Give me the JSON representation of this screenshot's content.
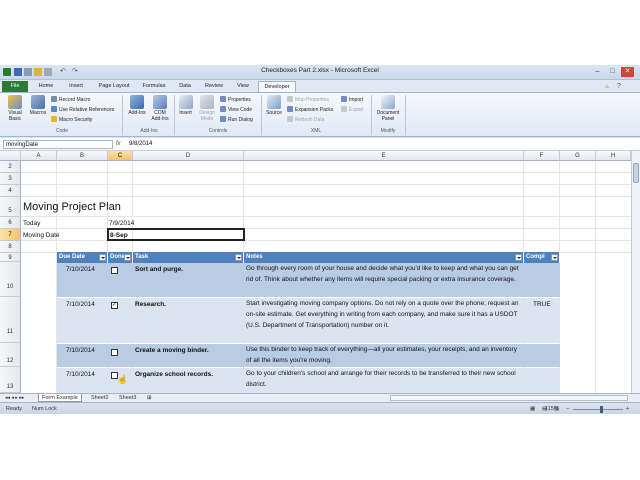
{
  "window": {
    "title": "Checkboxes Part 2.xlsx - Microsoft Excel",
    "controls": [
      "–",
      "□",
      "✕"
    ]
  },
  "ribbon": {
    "tabs": [
      "File",
      "Home",
      "Insert",
      "Page Layout",
      "Formulas",
      "Data",
      "Review",
      "View",
      "Developer"
    ],
    "active_tab": "Developer",
    "groups": {
      "code": {
        "label": "Code",
        "visual_basic": "Visual Basic",
        "macros": "Macros",
        "record_macro": "Record Macro",
        "relative_refs": "Use Relative References",
        "macro_security": "Macro Security"
      },
      "addins": {
        "label": "Add-Ins",
        "addins": "Add-Ins",
        "com_addins": "COM Add-Ins"
      },
      "controls": {
        "label": "Controls",
        "insert": "Insert",
        "design_mode": "Design Mode",
        "properties": "Properties",
        "view_code": "View Code",
        "run_dialog": "Run Dialog"
      },
      "xml": {
        "label": "XML",
        "source": "Source",
        "map_properties": "Map Properties",
        "expansion_packs": "Expansion Packs",
        "refresh_data": "Refresh Data",
        "import": "Import",
        "export": "Export"
      },
      "modify": {
        "label": "Modify",
        "document_panel": "Document Panel"
      }
    }
  },
  "formula_bar": {
    "name_box": "movingDate",
    "fx": "fx",
    "value": "9/8/2014"
  },
  "columns": [
    "A",
    "B",
    "C",
    "D",
    "E",
    "F",
    "G",
    "H"
  ],
  "selected_column": "C",
  "rows": [
    "2",
    "3",
    "4",
    "5",
    "6",
    "7",
    "8",
    "9",
    "10",
    "11",
    "12",
    "13"
  ],
  "selected_row": "7",
  "sheet": {
    "title": "Moving Project Plan",
    "today_label": "Today",
    "today_value": "7/9/2014",
    "moving_label": "Moving Date",
    "moving_value": "8-Sep"
  },
  "table": {
    "headers": [
      "Due Date",
      "Done",
      "Task",
      "Notes",
      "Compl"
    ],
    "rows": [
      {
        "due": "7/10/2014",
        "done": false,
        "task": "Sort and purge.",
        "notes": "Go through every room of your house and decide what you'd like to keep and what you can get rid of. Think about whether any items will require special packing or extra insurance coverage.",
        "complete": ""
      },
      {
        "due": "7/10/2014",
        "done": true,
        "task": "Research.",
        "notes": "Start investigating moving company options. Do not rely on a quote over the phone; request an on-site estimate. Get everything in writing from each company, and make sure it has a USDOT (U.S. Department of Transportation) number on it.",
        "complete": "TRUE"
      },
      {
        "due": "7/10/2014",
        "done": false,
        "task": "Create a moving binder.",
        "notes": "Use this binder to keep track of everything—all your estimates, your receipts, and an inventory of all the items you're moving.",
        "complete": ""
      },
      {
        "due": "7/10/2014",
        "done": false,
        "task": "Organize school records.",
        "notes": "Go to your children's school and arrange for their records to be transferred to their new school district.",
        "complete": ""
      }
    ]
  },
  "sheet_tabs": [
    "Form Example",
    "Sheet2",
    "Sheet3"
  ],
  "active_sheet": "Form Example",
  "status": {
    "mode": "Ready",
    "num_lock": "Num Lock",
    "zoom": "115%"
  },
  "colors": {
    "header_blue": "#4f81bd",
    "band_light": "#dbe5f1",
    "band_mid": "#b8cce4",
    "file_green": "#2a7a2f",
    "selection_orange": "#f5c46b"
  }
}
